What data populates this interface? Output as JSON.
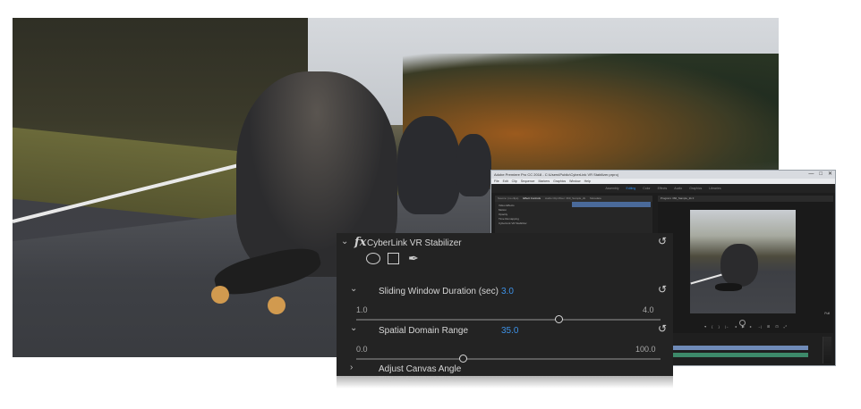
{
  "app": {
    "title": "Adobe Premiere Pro CC 2018 - C:\\Users\\Public\\CyberLink VR Stabilizer.prproj",
    "window_buttons": [
      "—",
      "□",
      "✕"
    ],
    "menu": [
      "File",
      "Edit",
      "Clip",
      "Sequence",
      "Markers",
      "Graphics",
      "Window",
      "Help"
    ],
    "workspaces": [
      "Assembly",
      "Editing",
      "Color",
      "Effects",
      "Audio",
      "Graphics",
      "Libraries"
    ],
    "active_workspace": "Editing",
    "left_tabs": [
      "Source: (no clips)",
      "Effect Controls",
      "Audio Clip Mixer: 360_Sample_2k",
      "Metadata"
    ],
    "active_left_tab": "Effect Controls",
    "effect_rows": [
      "Video Effects",
      "Motion",
      "Opacity",
      "Time Remapping",
      "CyberLink VR Stabilizer"
    ],
    "program_tab": "Program: 360_Sample_2k ≡",
    "transport": [
      "▾",
      "{",
      "}",
      "|←",
      "◂",
      "▶",
      "▸",
      "→|",
      "⊞",
      "⊡",
      "⤢"
    ],
    "full_label": "Full"
  },
  "fx": {
    "effect_name": "CyberLink VR Stabilizer",
    "fx_label": "fx",
    "params": [
      {
        "label": "Sliding Window Duration (sec)",
        "value": "3.0",
        "min": "1.0",
        "max": "4.0",
        "level": 0.667
      },
      {
        "label": "Spatial Domain Range",
        "value": "35.0",
        "min": "0.0",
        "max": "100.0",
        "level": 0.35
      }
    ],
    "collapsed_param": "Adjust Canvas Angle"
  },
  "icons": {
    "expand": "chevron-down-icon",
    "collapsed": "chevron-right-icon",
    "reset": "reset-icon",
    "mask_ellipse": "ellipse-mask-icon",
    "mask_rect": "rectangle-mask-icon",
    "mask_pen": "pen-mask-icon"
  },
  "colors": {
    "value_blue": "#3d92e8",
    "panel_bg": "#232323",
    "accent_workspace": "#2d8ceb"
  }
}
